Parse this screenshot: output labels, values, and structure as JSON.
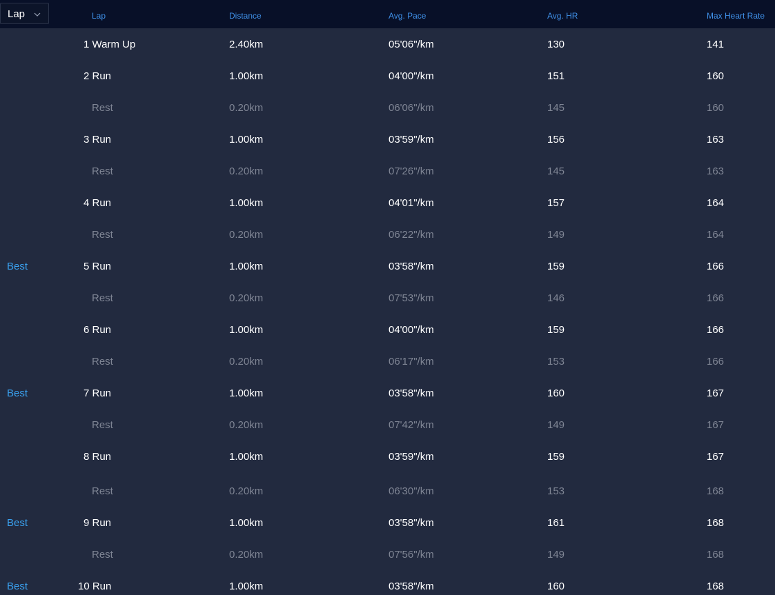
{
  "dropdown": {
    "label": "Lap",
    "icon": "chevron-down-icon"
  },
  "columns": {
    "lap": "Lap",
    "distance": "Distance",
    "avg_pace": "Avg. Pace",
    "avg_hr": "Avg. HR",
    "max_hr": "Max Heart Rate"
  },
  "colors": {
    "header_bg": "#081028",
    "body_bg": "#222a3f",
    "accent": "#3f8fe6",
    "best": "#3aa1ef",
    "rest_text": "#7f8594"
  },
  "rows": [
    {
      "type": "run",
      "best": "",
      "lap": "1 Warm Up",
      "distance": "2.40km",
      "pace": "05'06\"/km",
      "hr": "130",
      "max": "141"
    },
    {
      "type": "run",
      "best": "",
      "lap": "2 Run",
      "distance": "1.00km",
      "pace": "04'00\"/km",
      "hr": "151",
      "max": "160"
    },
    {
      "type": "rest",
      "best": "",
      "lap": "Rest",
      "distance": "0.20km",
      "pace": "06'06\"/km",
      "hr": "145",
      "max": "160"
    },
    {
      "type": "run",
      "best": "",
      "lap": "3 Run",
      "distance": "1.00km",
      "pace": "03'59\"/km",
      "hr": "156",
      "max": "163"
    },
    {
      "type": "rest",
      "best": "",
      "lap": "Rest",
      "distance": "0.20km",
      "pace": "07'26\"/km",
      "hr": "145",
      "max": "163"
    },
    {
      "type": "run",
      "best": "",
      "lap": "4 Run",
      "distance": "1.00km",
      "pace": "04'01\"/km",
      "hr": "157",
      "max": "164"
    },
    {
      "type": "rest",
      "best": "",
      "lap": "Rest",
      "distance": "0.20km",
      "pace": "06'22\"/km",
      "hr": "149",
      "max": "164"
    },
    {
      "type": "run",
      "best": "Best",
      "lap": "5 Run",
      "distance": "1.00km",
      "pace": "03'58\"/km",
      "hr": "159",
      "max": "166"
    },
    {
      "type": "rest",
      "best": "",
      "lap": "Rest",
      "distance": "0.20km",
      "pace": "07'53\"/km",
      "hr": "146",
      "max": "166"
    },
    {
      "type": "run",
      "best": "",
      "lap": "6 Run",
      "distance": "1.00km",
      "pace": "04'00\"/km",
      "hr": "159",
      "max": "166"
    },
    {
      "type": "rest",
      "best": "",
      "lap": "Rest",
      "distance": "0.20km",
      "pace": "06'17\"/km",
      "hr": "153",
      "max": "166"
    },
    {
      "type": "run",
      "best": "Best",
      "lap": "7 Run",
      "distance": "1.00km",
      "pace": "03'58\"/km",
      "hr": "160",
      "max": "167"
    },
    {
      "type": "rest",
      "best": "",
      "lap": "Rest",
      "distance": "0.20km",
      "pace": "07'42\"/km",
      "hr": "149",
      "max": "167"
    },
    {
      "type": "run",
      "best": "",
      "lap": "8 Run",
      "distance": "1.00km",
      "pace": "03'59\"/km",
      "hr": "159",
      "max": "167"
    },
    {
      "type": "rest",
      "best": "",
      "lap": "Rest",
      "distance": "0.20km",
      "pace": "06'30\"/km",
      "hr": "153",
      "max": "168"
    },
    {
      "type": "run",
      "best": "Best",
      "lap": "9 Run",
      "distance": "1.00km",
      "pace": "03'58\"/km",
      "hr": "161",
      "max": "168"
    },
    {
      "type": "rest",
      "best": "",
      "lap": "Rest",
      "distance": "0.20km",
      "pace": "07'56\"/km",
      "hr": "149",
      "max": "168"
    },
    {
      "type": "run",
      "best": "Best",
      "lap": "10 Run",
      "distance": "1.00km",
      "pace": "03'58\"/km",
      "hr": "160",
      "max": "168"
    }
  ]
}
